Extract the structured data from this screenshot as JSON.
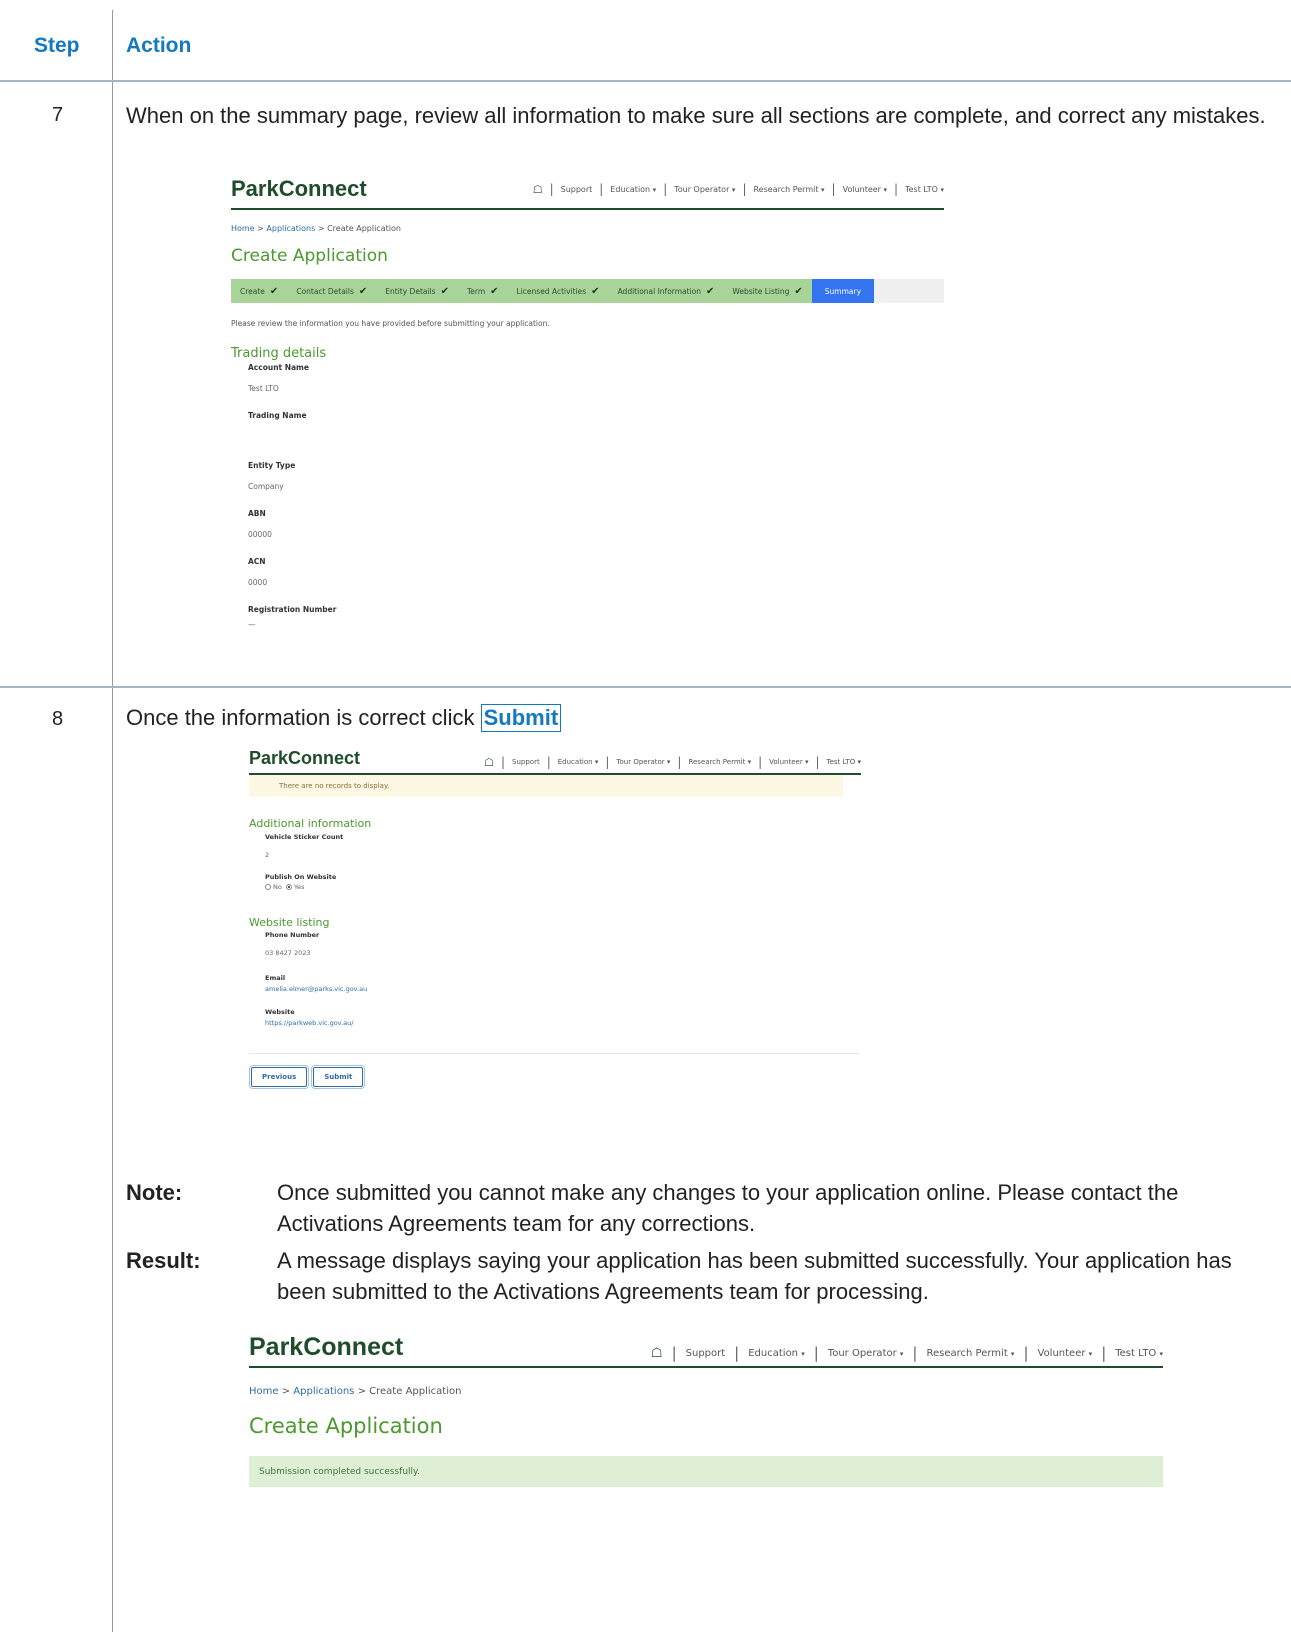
{
  "table": {
    "header_step": "Step",
    "header_action": "Action"
  },
  "step7": {
    "number": "7",
    "text": "When on the summary page, review all information to make sure all sections are complete, and correct any mistakes."
  },
  "step8": {
    "number": "8",
    "text_before": "Once the information is correct click",
    "button_ref": "Submit",
    "note_label": "Note:",
    "note_text": "Once submitted you cannot make any changes to your application online. Please contact the Activations Agreements team for any corrections.",
    "result_label": "Result:",
    "result_text": "A message displays saying your application has been submitted successfully. Your application has been submitted to the Activations Agreements team for processing."
  },
  "parkconnect": {
    "logo": "ParkConnect",
    "nav": {
      "home_icon": "home-icon",
      "support": "Support",
      "education": "Education",
      "tour_operator": "Tour Operator",
      "research_permit": "Research Permit",
      "volunteer": "Volunteer",
      "account": "Test LTO",
      "caret": "▾",
      "separator": "|"
    },
    "breadcrumb": {
      "home": "Home",
      "applications": "Applications",
      "current": "Create Application",
      "sep": ">"
    },
    "page_title": "Create Application"
  },
  "summary_screen": {
    "wizard_tabs": [
      {
        "label": "Create",
        "done": "✔"
      },
      {
        "label": "Contact Details",
        "done": "✔"
      },
      {
        "label": "Entity Details",
        "done": "✔"
      },
      {
        "label": "Term",
        "done": "✔"
      },
      {
        "label": "Licensed Activities",
        "done": "✔"
      },
      {
        "label": "Additional Information",
        "done": "✔"
      },
      {
        "label": "Website Listing",
        "done": "✔"
      },
      {
        "label": "Summary",
        "done": ""
      }
    ],
    "intro": "Please review the information you have provided before submitting your application.",
    "section_title": "Trading details",
    "fields": [
      {
        "label": "Account Name",
        "value": "Test LTO"
      },
      {
        "label": "Trading Name",
        "value": ""
      },
      {
        "label": "Entity Type",
        "value": "Company"
      },
      {
        "label": "ABN",
        "value": "00000"
      },
      {
        "label": "ACN",
        "value": "0000"
      },
      {
        "label": "Registration Number",
        "value": "—"
      }
    ]
  },
  "submit_screen": {
    "no_records": "There are no records to display.",
    "additional_title": "Additional information",
    "vehicle_label": "Vehicle Sticker Count",
    "vehicle_value": "2",
    "publish_label": "Publish On Website",
    "radio_no": "No",
    "radio_yes": "Yes",
    "website_title": "Website listing",
    "phone_label": "Phone Number",
    "phone_value": "03 8427 2023",
    "email_label": "Email",
    "email_value": "amelia.elmer@parks.vic.gov.au",
    "website_label": "Website",
    "website_value": "https://parkweb.vic.gov.au/",
    "previous_button": "Previous",
    "submit_button": "Submit"
  },
  "success_screen": {
    "message": "Submission completed successfully."
  }
}
